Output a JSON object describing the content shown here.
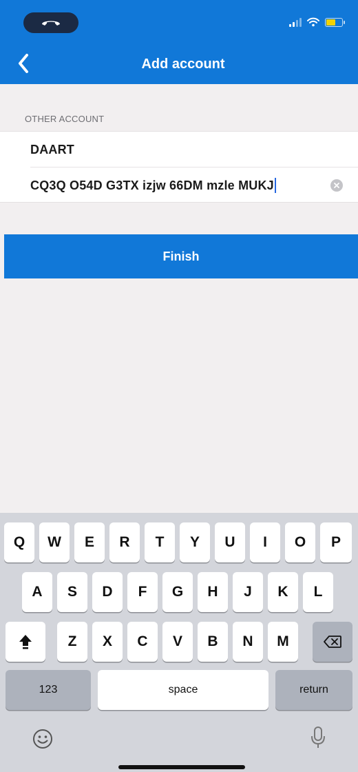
{
  "status_bar": {
    "call_icon": "phone-hangup-icon",
    "icons": [
      "signal-icon",
      "wifi-icon",
      "battery-icon"
    ]
  },
  "nav": {
    "title": "Add account",
    "back_icon": "chevron-left-icon"
  },
  "form": {
    "section_header": "OTHER ACCOUNT",
    "fields": [
      {
        "value": "DAART"
      },
      {
        "value": "CQ3Q O54D G3TX izjw 66DM mzle MUKJ"
      }
    ],
    "clear_icon": "clear-circle-icon"
  },
  "finish_label": "Finish",
  "keyboard": {
    "row1": [
      "Q",
      "W",
      "E",
      "R",
      "T",
      "Y",
      "U",
      "I",
      "O",
      "P"
    ],
    "row2": [
      "A",
      "S",
      "D",
      "F",
      "G",
      "H",
      "J",
      "K",
      "L"
    ],
    "row3": [
      "Z",
      "X",
      "C",
      "V",
      "B",
      "N",
      "M"
    ],
    "numbers_label": "123",
    "space_label": "space",
    "return_label": "return",
    "icons": [
      "shift-icon",
      "backspace-icon",
      "emoji-icon",
      "microphone-icon"
    ]
  },
  "colors": {
    "accent": "#1178d8",
    "background": "#f2eff0",
    "keyboard_bg": "#d3d5db"
  }
}
